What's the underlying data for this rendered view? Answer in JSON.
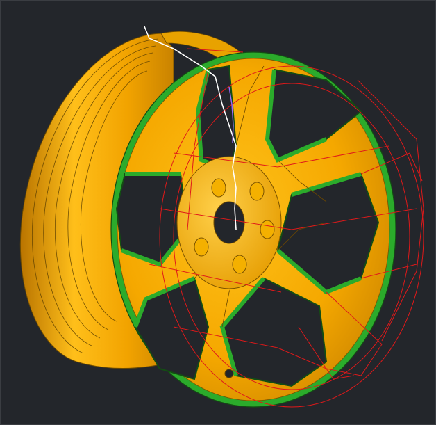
{
  "viewport": {
    "background": "#23262b",
    "colors": {
      "rim": "#f2a900",
      "rim_light": "#ffc21a",
      "rim_dark": "#a86c00",
      "face": "#2bab2b",
      "face_light": "#5ad12e",
      "toolpath": "#e0191a",
      "cursor_path": "#ffffff",
      "accent_path": "#9b6cff"
    },
    "model": {
      "name": "wheel-rim",
      "spokes": 5,
      "lug_holes": 5,
      "toolpath_visible": true
    }
  }
}
